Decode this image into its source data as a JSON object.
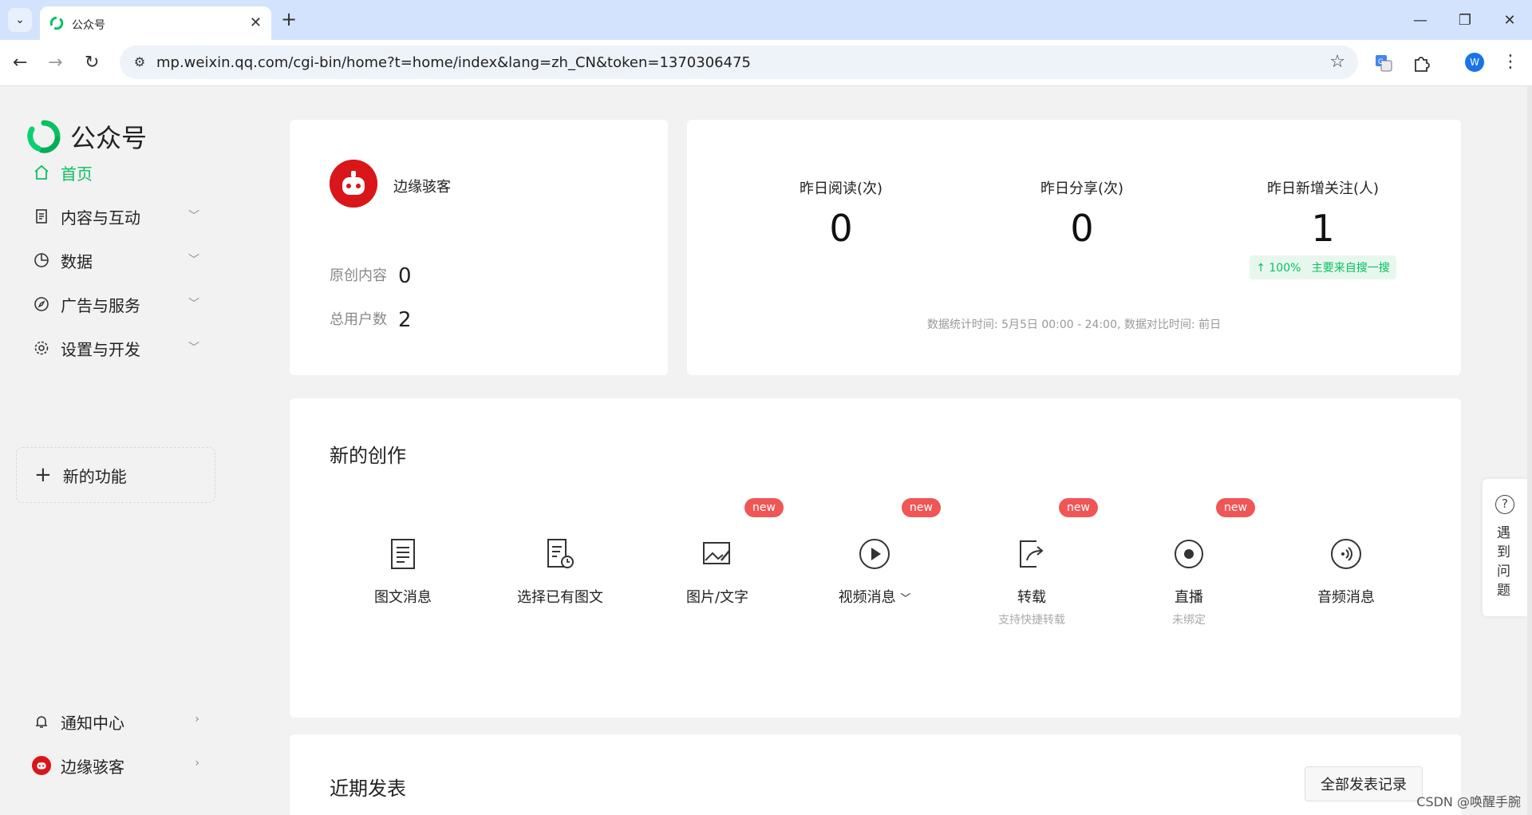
{
  "browser": {
    "tab_title": "公众号",
    "url": "mp.weixin.qq.com/cgi-bin/home?t=home/index&lang=zh_CN&token=1370306475",
    "profile_initial": "W"
  },
  "brand": {
    "title": "公众号",
    "color": "#07c160"
  },
  "sidebar": {
    "items": [
      {
        "label": "首页",
        "icon": "home-icon",
        "active": true
      },
      {
        "label": "内容与互动",
        "icon": "document-icon"
      },
      {
        "label": "数据",
        "icon": "pie-chart-icon"
      },
      {
        "label": "广告与服务",
        "icon": "compass-icon"
      },
      {
        "label": "设置与开发",
        "icon": "gear-icon"
      }
    ],
    "new_feature": "新的功能",
    "bottom": [
      {
        "label": "通知中心",
        "icon": "bell-icon"
      },
      {
        "label": "边缘骇客",
        "icon": "avatar-icon"
      }
    ]
  },
  "account": {
    "name": "边缘骇客",
    "original_label": "原创内容",
    "original_value": "0",
    "users_label": "总用户数",
    "users_value": "2"
  },
  "stats": {
    "reads_label": "昨日阅读(次)",
    "reads_value": "0",
    "shares_label": "昨日分享(次)",
    "shares_value": "0",
    "follows_label": "昨日新增关注(人)",
    "follows_value": "1",
    "growth": "↑ 100%",
    "growth_source": "主要来自搜一搜",
    "footnote": "数据统计时间: 5月5日 00:00 - 24:00, 数据对比时间: 前日"
  },
  "create": {
    "title": "新的创作",
    "new_badge": "new",
    "items": [
      {
        "label": "图文消息",
        "sub": "",
        "icon": "article-icon"
      },
      {
        "label": "选择已有图文",
        "sub": "",
        "icon": "article-history-icon"
      },
      {
        "label": "图片/文字",
        "sub": "",
        "icon": "image-text-icon"
      },
      {
        "label": "视频消息",
        "sub": "",
        "icon": "play-icon"
      },
      {
        "label": "转载",
        "sub": "支持快捷转载",
        "icon": "share-icon"
      },
      {
        "label": "直播",
        "sub": "未绑定",
        "icon": "live-icon"
      },
      {
        "label": "音频消息",
        "sub": "",
        "icon": "audio-icon"
      }
    ]
  },
  "recent": {
    "title": "近期发表",
    "all_records": "全部发表记录"
  },
  "help": {
    "text": "遇到问题"
  },
  "watermark": "CSDN @唤醒手腕"
}
